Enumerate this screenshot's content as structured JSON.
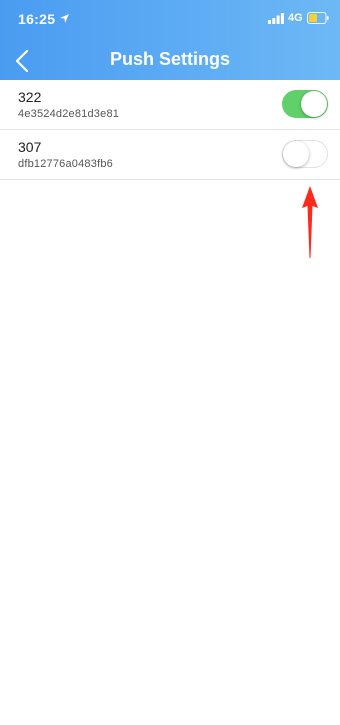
{
  "status_bar": {
    "time": "16:25",
    "network": "4G"
  },
  "header": {
    "title": "Push Settings"
  },
  "devices": [
    {
      "name": "322",
      "id": "4e3524d2e81d3e81",
      "enabled": true
    },
    {
      "name": "307",
      "id": "dfb12776a0483fb6",
      "enabled": false
    }
  ],
  "colors": {
    "header_gradient_start": "#4a9cf2",
    "header_gradient_end": "#6db8f5",
    "toggle_on": "#5fd06a",
    "annotation_arrow": "#ff2a1a"
  }
}
